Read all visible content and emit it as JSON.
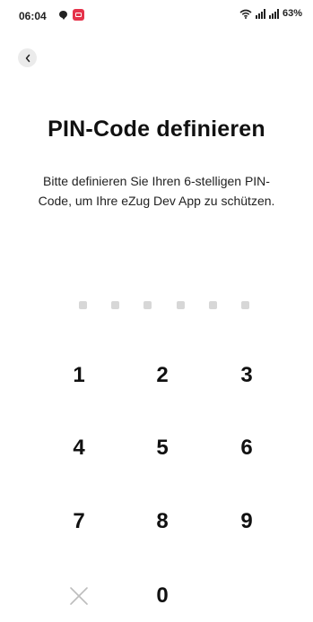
{
  "status_bar": {
    "time": "06:04",
    "battery": "63%",
    "icons": [
      "chat-icon",
      "media-app-icon",
      "wifi-icon",
      "signal-icon",
      "signal-icon"
    ],
    "media_icon_color": "#e5324a"
  },
  "header": {
    "back_icon": "chevron-left-icon"
  },
  "main": {
    "title": "PIN-Code definieren",
    "subtitle": "Bitte definieren Sie Ihren 6-stelligen PIN-Code, um Ihre eZug Dev App zu schützen.",
    "pin_length": 6,
    "pin_entered": 0,
    "empty_dot_color": "#d7d7d7"
  },
  "keypad": {
    "keys": [
      "1",
      "2",
      "3",
      "4",
      "5",
      "6",
      "7",
      "8",
      "9"
    ],
    "zero": "0",
    "clear_icon": "close-icon"
  }
}
